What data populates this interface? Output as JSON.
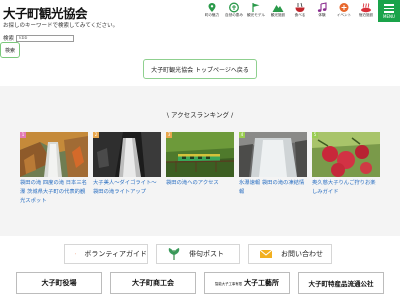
{
  "header": {
    "site_title": "大子町観光協会",
    "nav": [
      {
        "label": "町の魅力",
        "icon": "location-icon"
      },
      {
        "label": "自然の恵み",
        "icon": "nature-icon"
      },
      {
        "label": "観光モデル",
        "icon": "flag-icon"
      },
      {
        "label": "観光施設",
        "icon": "mountain-icon"
      },
      {
        "label": "食べる",
        "icon": "noodle-icon"
      },
      {
        "label": "体験",
        "icon": "music-icon"
      },
      {
        "label": "イベント",
        "icon": "event-icon"
      },
      {
        "label": "宿泊施設",
        "icon": "onsen-icon"
      },
      {
        "label": "アクセス",
        "icon": "car-icon"
      }
    ],
    "menu_label": "MENU",
    "menu_color": "#1aa34a"
  },
  "search": {
    "instruction": "お探しのキーワードで検索してみてください。",
    "label": "検索",
    "placeholder": "kbb",
    "button_label": "検索"
  },
  "top_link": "大子町観光協会 トップページへ戻る",
  "ranking": {
    "title": "\\ アクセスランキング /",
    "items": [
      {
        "rank": "1",
        "rank_color": "#e37ab5",
        "caption": "袋田の滝 四度の滝 日本三名瀑 茨城県大子町の代表的観光スポット"
      },
      {
        "rank": "2",
        "rank_color": "#e8a74e",
        "caption": "大子美人〜ダイゴライト〜 袋田の滝ライトアップ"
      },
      {
        "rank": "3",
        "rank_color": "#e8a74e",
        "caption": "袋田の滝へのアクセス"
      },
      {
        "rank": "4",
        "rank_color": "#9acd52",
        "caption": "氷瀑速報 袋田の滝の凍結情報"
      },
      {
        "rank": "5",
        "rank_color": "#9acd52",
        "caption": "奥久慈大子りんご狩りお楽しみガイド"
      }
    ]
  },
  "buttons": {
    "volunteer_guide": "ボランティアガイド",
    "haiku_post": "俳句ポスト",
    "contact": "お問い合わせ"
  },
  "organizations": {
    "town_office": "大子町役場",
    "commerce": "大子町商工会",
    "kougeisho_sub": "智能大子工事有限",
    "kougeisho": "大子工藝所",
    "distribution": "大子町特産品流通公社"
  }
}
